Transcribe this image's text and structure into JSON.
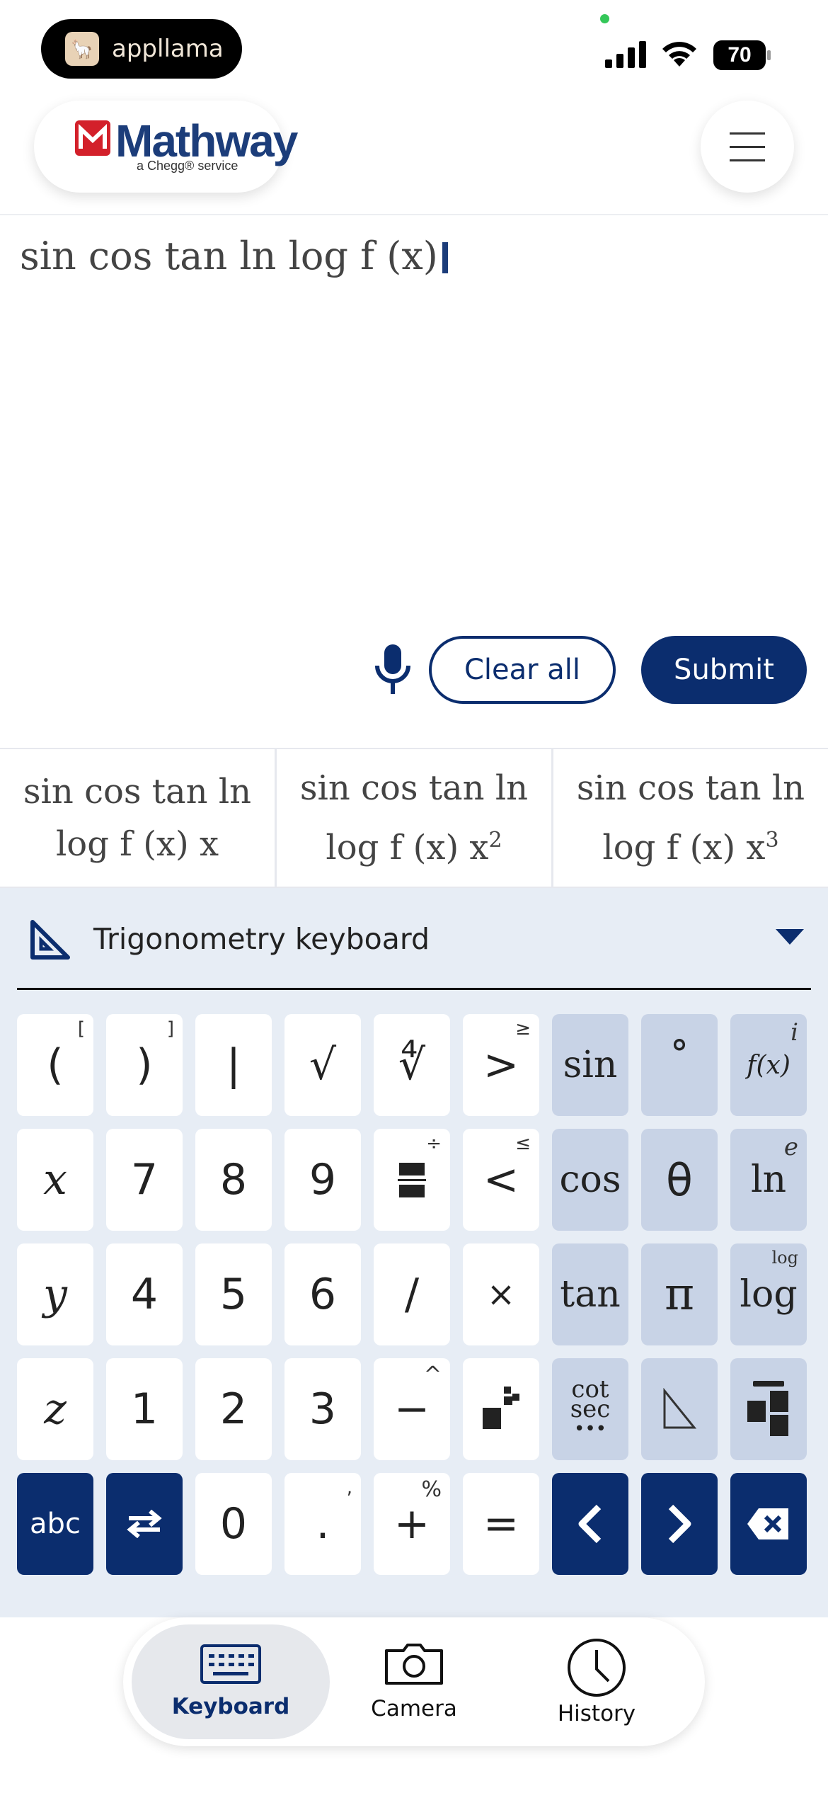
{
  "status_bar": {
    "app_pill": "appllama",
    "battery": "70"
  },
  "header": {
    "logo_text": "Mathway",
    "logo_sub": "a Chegg® service"
  },
  "input": {
    "expression": "sin cos tan ln log f (x)"
  },
  "actions": {
    "clear_label": "Clear all",
    "submit_label": "Submit"
  },
  "suggestions": [
    {
      "line1": "sin cos tan ln",
      "line2": "log f (x) x",
      "sup": ""
    },
    {
      "line1": "sin cos tan ln",
      "line2": "log f (x) x",
      "sup": "2"
    },
    {
      "line1": "sin cos tan ln",
      "line2": "log f (x) x",
      "sup": "3"
    }
  ],
  "keyboard": {
    "title": "Trigonometry keyboard",
    "keys": {
      "lparen": "(",
      "lparen_sub": "[",
      "rparen": ")",
      "rparen_sub": "]",
      "abs": "|",
      "sqrt": "√",
      "nroot": "∜",
      "gt": ">",
      "gt_sub": "≥",
      "sin": "sin",
      "degree": "°",
      "fx": "f(x)",
      "fx_sub": "i",
      "x": "x",
      "seven": "7",
      "eight": "8",
      "nine": "9",
      "div_sub": "÷",
      "lt": "<",
      "lt_sub": "≤",
      "cos": "cos",
      "theta": "θ",
      "ln": "ln",
      "ln_sub": "e",
      "y": "y",
      "four": "4",
      "five": "5",
      "six": "6",
      "slash": "/",
      "times": "×",
      "tan": "tan",
      "pi": "π",
      "log": "log",
      "log_sub": "log",
      "z": "z",
      "one": "1",
      "two": "2",
      "three": "3",
      "minus": "−",
      "minus_sub": "^",
      "cot": "cot",
      "sec": "sec",
      "abc": "abc",
      "zero": "0",
      "dot": ".",
      "dot_sub": ",",
      "plus": "+",
      "plus_sub": "%",
      "equals": "="
    }
  },
  "tabbar": {
    "keyboard": "Keyboard",
    "camera": "Camera",
    "history": "History"
  }
}
